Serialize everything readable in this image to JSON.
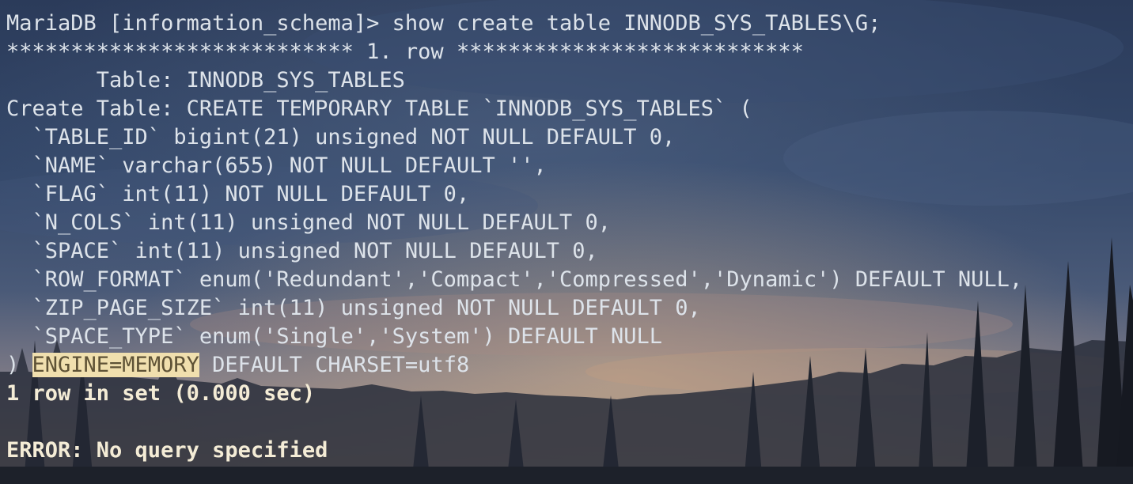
{
  "terminal": {
    "prompt": "MariaDB [information_schema]> ",
    "command": "show create table INNODB_SYS_TABLES\\G;",
    "row_separator": "*************************** 1. row ***************************",
    "table_line": "       Table: INNODB_SYS_TABLES",
    "create_line": "Create Table: CREATE TEMPORARY TABLE `INNODB_SYS_TABLES` (",
    "columns": [
      "  `TABLE_ID` bigint(21) unsigned NOT NULL DEFAULT 0,",
      "  `NAME` varchar(655) NOT NULL DEFAULT '',",
      "  `FLAG` int(11) NOT NULL DEFAULT 0,",
      "  `N_COLS` int(11) unsigned NOT NULL DEFAULT 0,",
      "  `SPACE` int(11) unsigned NOT NULL DEFAULT 0,",
      "  `ROW_FORMAT` enum('Redundant','Compact','Compressed','Dynamic') DEFAULT NULL,",
      "  `ZIP_PAGE_SIZE` int(11) unsigned NOT NULL DEFAULT 0,",
      "  `SPACE_TYPE` enum('Single','System') DEFAULT NULL"
    ],
    "closing_prefix": ") ",
    "selected_text": "ENGINE=MEMORY",
    "closing_suffix": " DEFAULT CHARSET=utf8",
    "result_summary": "1 row in set (0.000 sec)",
    "error_line": "ERROR: No query specified"
  },
  "colors": {
    "text": "#dde3ea",
    "bold_text": "#f4ecd6",
    "selection_bg": "#f0dfae"
  }
}
